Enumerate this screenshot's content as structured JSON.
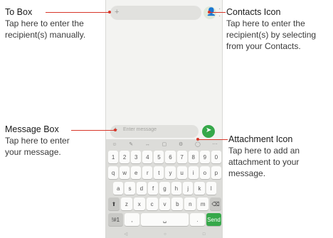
{
  "callouts": {
    "to_box": {
      "title": "To Box",
      "desc_lines": [
        "Tap here to enter the",
        "recipient(s) manually."
      ]
    },
    "contacts_icon": {
      "title": "Contacts Icon",
      "desc_lines": [
        "Tap here to enter the",
        "recipient(s) by selecting",
        "from your Contacts."
      ]
    },
    "message_box": {
      "title": "Message Box",
      "desc_lines": [
        "Tap here to enter",
        "your message."
      ]
    },
    "attachment_icon": {
      "title": "Attachment Icon",
      "desc_lines": [
        "Tap here to add an",
        "attachment to your",
        "message."
      ]
    }
  },
  "phone": {
    "message_placeholder": "Enter message",
    "keyboard": {
      "toolbar": [
        "☺",
        "✎",
        "↔",
        "▢",
        "⚙",
        "◯",
        "⋯"
      ],
      "row_numbers": [
        "1",
        "2",
        "3",
        "4",
        "5",
        "6",
        "7",
        "8",
        "9",
        "0"
      ],
      "row_1": [
        "q",
        "w",
        "e",
        "r",
        "t",
        "y",
        "u",
        "i",
        "o",
        "p"
      ],
      "row_2": [
        "a",
        "s",
        "d",
        "f",
        "g",
        "h",
        "j",
        "k",
        "l"
      ],
      "row_3": [
        "z",
        "x",
        "c",
        "v",
        "b",
        "n",
        "m"
      ],
      "symbols_key": "!#1",
      "comma_key": ",",
      "period_key": ".",
      "go_key": "Send",
      "nav_bar": [
        "◁",
        "○",
        "□"
      ]
    }
  },
  "colors": {
    "leader_line": "#d8372a",
    "send_button": "#36a84a"
  }
}
